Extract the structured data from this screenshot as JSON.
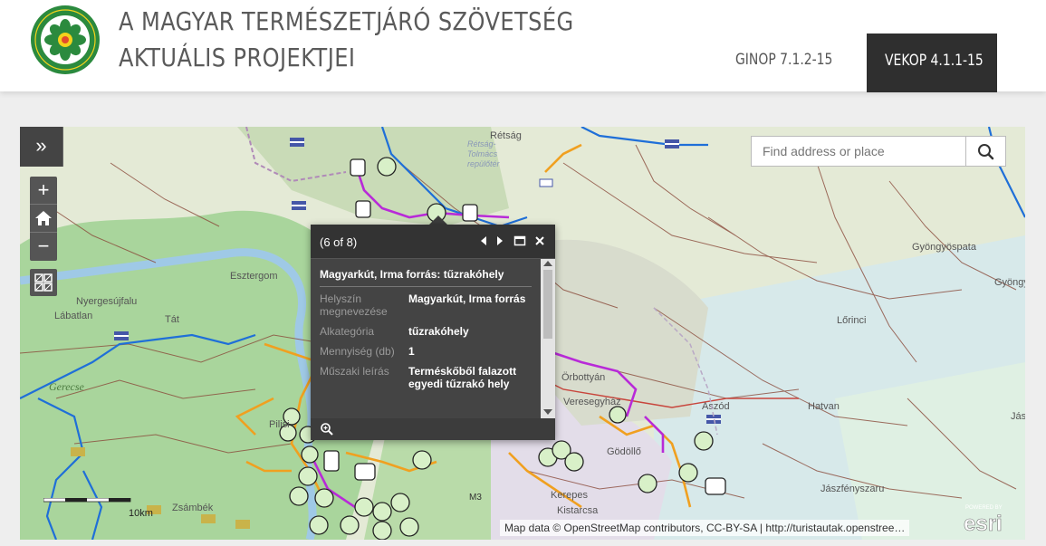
{
  "header": {
    "logo_text": "MAGYAR TERMÉSZETJÁRÓ SZÖVETSÉG",
    "title_line1": "A MAGYAR TERMÉSZETJÁRÓ SZÖVETSÉG",
    "title_line2": "AKTUÁLIS PROJEKTJEI",
    "nav": [
      {
        "label": "GINOP 7.1.2-15",
        "active": false
      },
      {
        "label": "VEKOP 4.1.1-15",
        "active": true
      }
    ]
  },
  "map": {
    "search_placeholder": "Find address or place",
    "attribution": "Map data © OpenStreetMap contributors, CC-BY-SA | http://turistautak.openstree…",
    "powered_by": "POWERED BY",
    "esri_label": "esri",
    "scale_label": "10km",
    "place_labels": [
      "Rétság",
      "Rétság-\nTolmács\nrepülőtér",
      "Gyöngyöspata",
      "Gyöngy",
      "Esztergom",
      "Nyergesújfalu",
      "Lábatlan",
      "Tát",
      "Lőrinci",
      "Örbottyán",
      "Veresegyház",
      "Aszód",
      "Hatvan",
      "Gödöllő",
      "Jászfényszaru",
      "Pilisi",
      "Zsámbék",
      "Kistarcsa",
      "Kerepes",
      "Gerecse",
      "Jás",
      "M3"
    ],
    "colors": {
      "hiking_blue": "#1f6fd8",
      "hiking_orange": "#f0a020",
      "route_magenta": "#b82ad8",
      "road_brown": "#8a4a3a",
      "forest": "#a7d49a"
    }
  },
  "popup": {
    "count": "(6 of 8)",
    "title": "Magyarkút, Irma forrás: tűzrakóhely",
    "fields": [
      {
        "label": "Helyszín megnevezése",
        "value": "Magyarkút, Irma forrás"
      },
      {
        "label": "Alkategória",
        "value": "tűzrakóhely"
      },
      {
        "label": "Mennyiség (db)",
        "value": "1"
      },
      {
        "label": "Műszaki leírás",
        "value": "Terméskőből falazott egyedi tűzrakó hely"
      }
    ]
  }
}
